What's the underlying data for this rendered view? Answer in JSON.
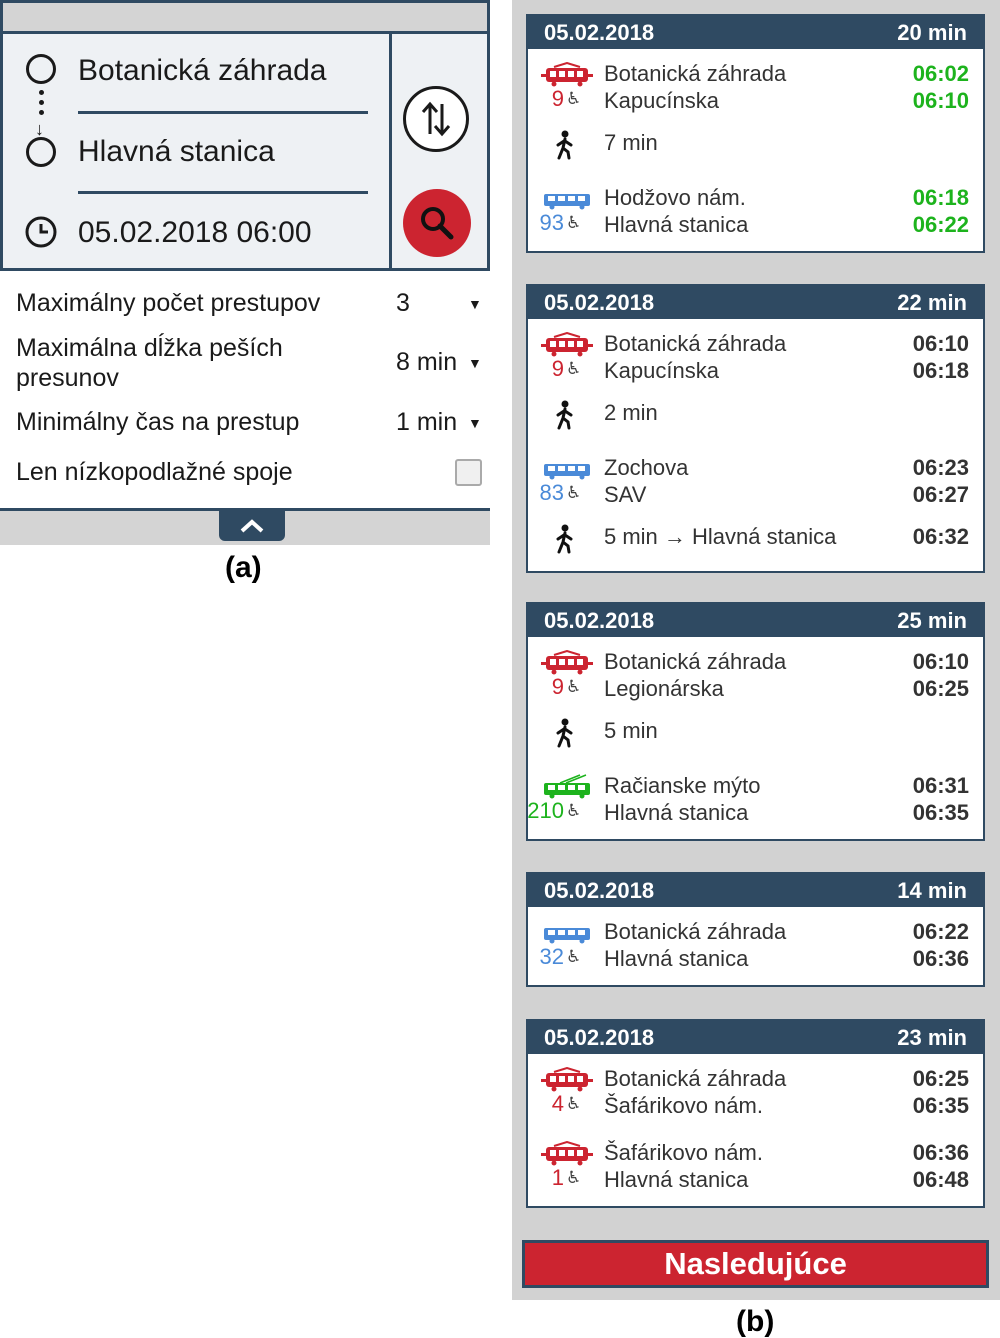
{
  "panel_a": {
    "from": "Botanická záhrada",
    "to": "Hlavná stanica",
    "datetime": "05.02.2018 06:00",
    "options": [
      {
        "label": "Maximálny počet prestupov",
        "value": "3"
      },
      {
        "label": "Maximálna dĺžka peších presunov",
        "value": "8 min"
      },
      {
        "label": "Minimálny čas na prestup",
        "value": "1 min"
      },
      {
        "label": "Len nízkopodlažné spoje",
        "checked": false
      }
    ],
    "caption": "(a)"
  },
  "panel_b": {
    "caption": "(b)",
    "next_label": "Nasledujúce",
    "colors": {
      "tram": "#cc2430",
      "bus": "#4a8ad8",
      "trolleybus": "#1db31d",
      "header": "#2f4a62",
      "green_time": "#1db31d"
    },
    "connections": [
      {
        "date": "05.02.2018",
        "duration": "20 min",
        "legs": [
          {
            "kind": "ride",
            "vehicle": "tram",
            "line": "9",
            "from": "Botanická záhrada",
            "to": "Kapucínska",
            "dep": "06:02",
            "arr": "06:10",
            "realtime": true
          },
          {
            "kind": "walk",
            "text": "7 min"
          },
          {
            "kind": "ride",
            "vehicle": "bus",
            "line": "93",
            "from": "Hodžovo nám.",
            "to": "Hlavná stanica",
            "dep": "06:18",
            "arr": "06:22",
            "realtime": true
          }
        ]
      },
      {
        "date": "05.02.2018",
        "duration": "22 min",
        "legs": [
          {
            "kind": "ride",
            "vehicle": "tram",
            "line": "9",
            "from": "Botanická záhrada",
            "to": "Kapucínska",
            "dep": "06:10",
            "arr": "06:18"
          },
          {
            "kind": "walk",
            "text": "2 min"
          },
          {
            "kind": "ride",
            "vehicle": "bus",
            "line": "83",
            "from": "Zochova",
            "to": "SAV",
            "dep": "06:23",
            "arr": "06:27"
          },
          {
            "kind": "walk",
            "text": "5 min → Hlavná stanica",
            "time": "06:32"
          }
        ]
      },
      {
        "date": "05.02.2018",
        "duration": "25 min",
        "legs": [
          {
            "kind": "ride",
            "vehicle": "tram",
            "line": "9",
            "from": "Botanická záhrada",
            "to": "Legionárska",
            "dep": "06:10",
            "arr": "06:25"
          },
          {
            "kind": "walk",
            "text": "5 min"
          },
          {
            "kind": "ride",
            "vehicle": "trolleybus",
            "line": "210",
            "from": "Račianske mýto",
            "to": "Hlavná stanica",
            "dep": "06:31",
            "arr": "06:35"
          }
        ]
      },
      {
        "date": "05.02.2018",
        "duration": "14 min",
        "legs": [
          {
            "kind": "ride",
            "vehicle": "bus",
            "line": "32",
            "from": "Botanická záhrada",
            "to": "Hlavná stanica",
            "dep": "06:22",
            "arr": "06:36"
          }
        ]
      },
      {
        "date": "05.02.2018",
        "duration": "23 min",
        "legs": [
          {
            "kind": "ride",
            "vehicle": "tram",
            "line": "4",
            "from": "Botanická záhrada",
            "to": "Šafárikovo nám.",
            "dep": "06:25",
            "arr": "06:35"
          },
          {
            "kind": "ride",
            "vehicle": "tram",
            "line": "1",
            "from": "Šafárikovo nám.",
            "to": "Hlavná stanica",
            "dep": "06:36",
            "arr": "06:48"
          }
        ]
      }
    ]
  }
}
